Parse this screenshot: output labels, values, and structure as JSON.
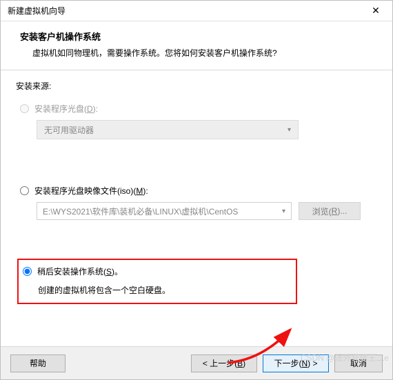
{
  "window": {
    "title": "新建虚拟机向导",
    "close": "✕"
  },
  "header": {
    "title": "安装客户机操作系统",
    "subtitle": "虚拟机如同物理机，需要操作系统。您将如何安装客户机操作系统?"
  },
  "content": {
    "source_label": "安装来源:",
    "opt_disc": {
      "label_pre": "安装程序光盘(",
      "hot": "D",
      "label_post": "):"
    },
    "dropdown": {
      "value": "无可用驱动器"
    },
    "opt_iso": {
      "label_pre": "安装程序光盘映像文件(iso)(",
      "hot": "M",
      "label_post": "):"
    },
    "iso_path": "E:\\WYS2021\\软件库\\装机必备\\LINUX\\虚拟机\\CentOS",
    "browse": {
      "label_pre": "浏览(",
      "hot": "R",
      "label_post": ")..."
    },
    "opt_later": {
      "label_pre": "稍后安装操作系统(",
      "hot": "S",
      "label_post": ")。"
    },
    "later_desc": "创建的虚拟机将包含一个空白硬盘。"
  },
  "footer": {
    "help": "帮助",
    "back": {
      "label_pre": "< 上一步(",
      "hot": "B",
      "label_post": ")"
    },
    "next": {
      "label_pre": "下一步(",
      "hot": "N",
      "label_post": ") >"
    },
    "cancel": "取消"
  },
  "watermark": "CSDN @法外狂徒王二e"
}
